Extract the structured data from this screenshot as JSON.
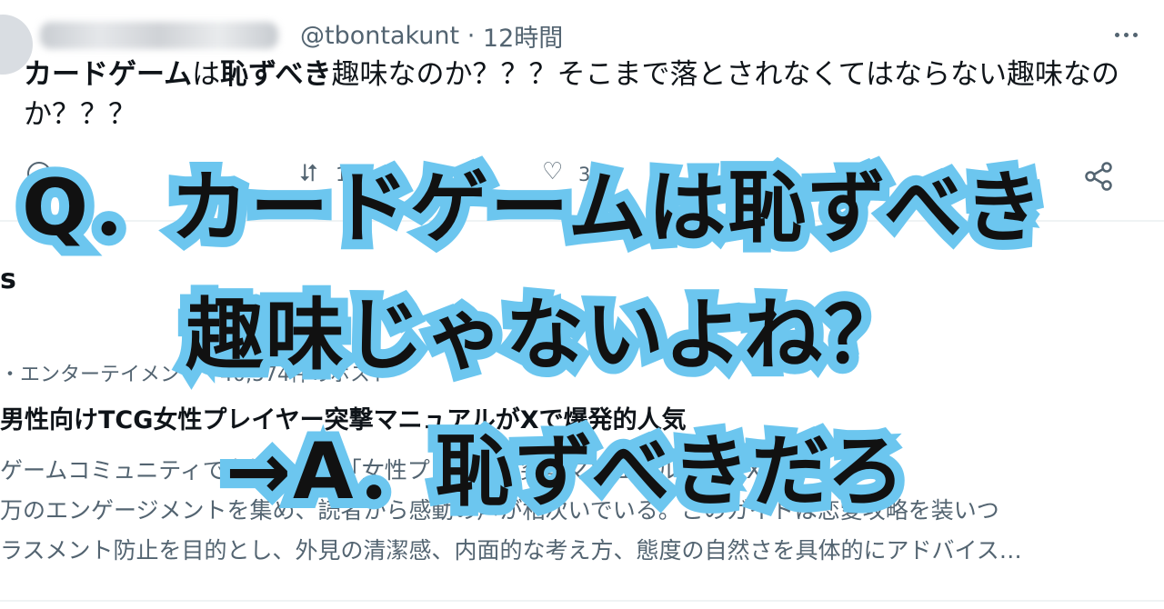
{
  "tweet": {
    "handle": "@tbontakunt",
    "separator": "·",
    "time": "12時間",
    "text_bold": "カードゲーム",
    "text_1": "は",
    "text_bold_2": "恥ずべき",
    "text_rest": "趣味なのか？？？そこまで落とされなくてはならない趣味なのか？？？",
    "retweets": "114",
    "likes": "342"
  },
  "trends": {
    "header": "s",
    "meta": "・エンターテイメント・40,574件のポスト",
    "title": "男性向けTCG女性プレイヤー突撃マニュアルがXで爆発的人気",
    "body_lines": [
      "ゲームコミュニティで女性向けに「女性プレイヤー突撃マニュアル」が、X",
      "万のエンゲージメントを集め、読者から感動の声が相次いでいる。このガイドは恋愛攻略を装いつ",
      "ラスメント防止を目的とし、外見の清潔感、内面的な考え方、態度の自然さを具体的にアドバイス…"
    ]
  },
  "captions": {
    "q": "Q．カードゲームは恥ずべき",
    "q_cont": "趣味じゃないよね？",
    "a": "→A．恥ずべきだろ"
  },
  "colors": {
    "caption_outline": "#6cc6ef",
    "caption_fill": "#111111",
    "secondary_text": "#536471"
  },
  "icons": [
    "more-icon",
    "reply-icon",
    "retweet-icon",
    "like-icon",
    "share-icon"
  ]
}
